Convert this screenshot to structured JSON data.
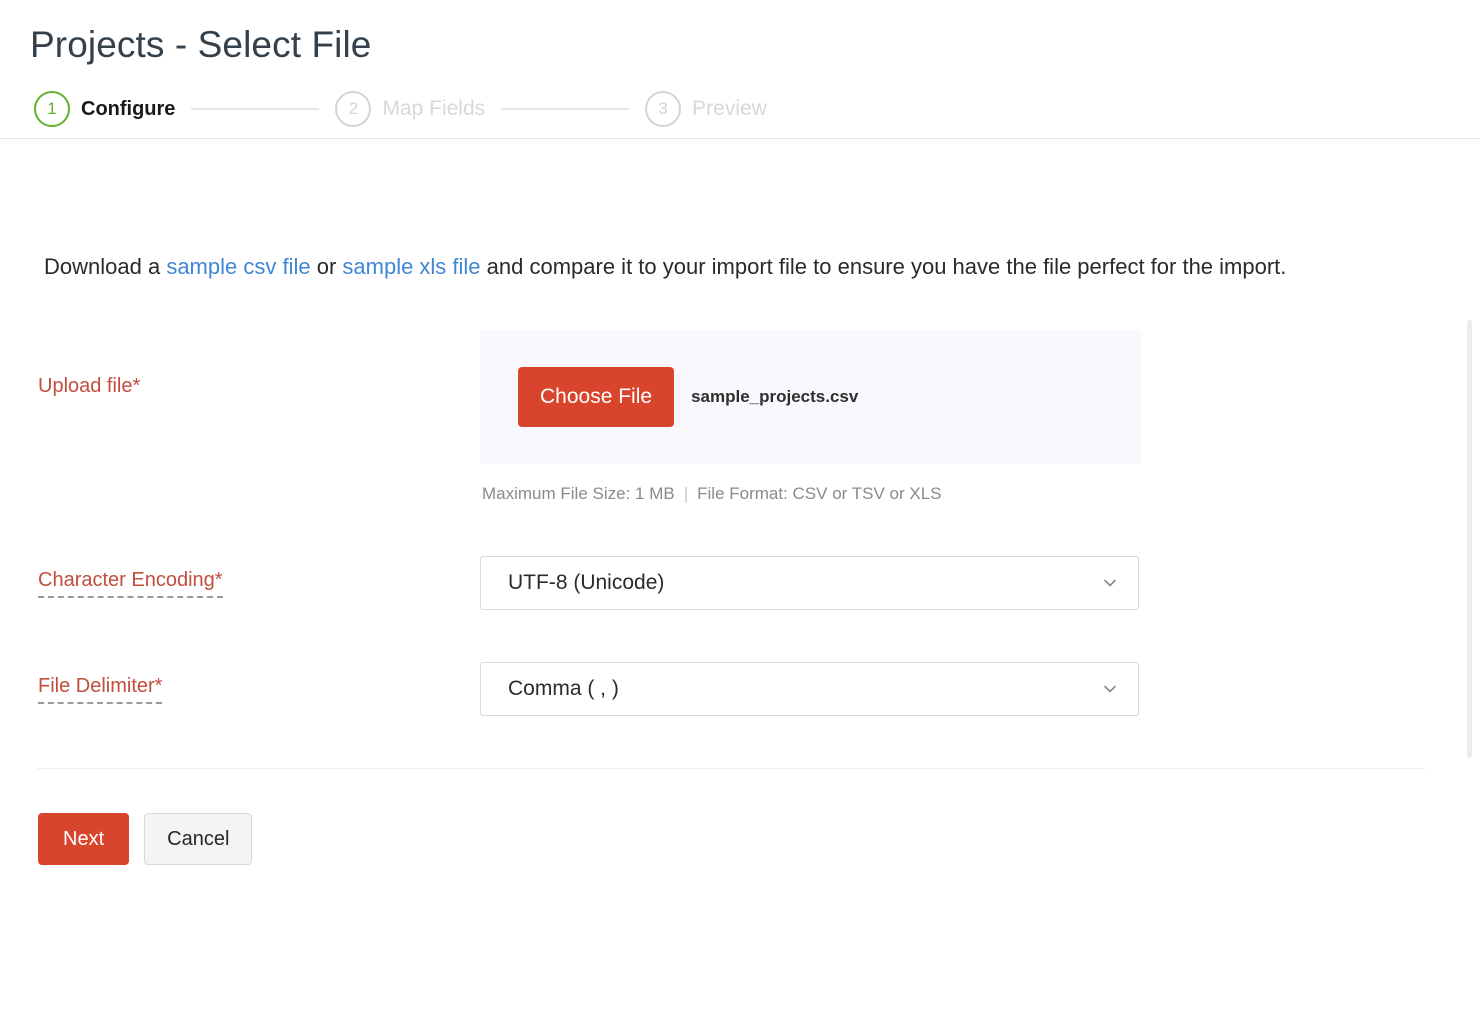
{
  "page": {
    "title": "Projects - Select File"
  },
  "stepper": {
    "steps": [
      {
        "number": "1",
        "label": "Configure",
        "state": "active"
      },
      {
        "number": "2",
        "label": "Map Fields",
        "state": "inactive"
      },
      {
        "number": "3",
        "label": "Preview",
        "state": "inactive"
      }
    ]
  },
  "intro": {
    "lead": "Download a ",
    "link_csv": "sample csv file",
    "between": " or ",
    "link_xls": "sample xls file",
    "tail": " and compare it to your import file to ensure you have the file perfect for the import."
  },
  "form": {
    "upload": {
      "label": "Upload file*",
      "choose_button": "Choose File",
      "file_name": "sample_projects.csv",
      "hint_size": "Maximum File Size: 1 MB",
      "hint_separator": "|",
      "hint_format": "File Format: CSV or TSV or XLS"
    },
    "encoding": {
      "label": "Character Encoding*",
      "value": "UTF-8 (Unicode)",
      "icon": "chevron-down-icon"
    },
    "delimiter": {
      "label": "File Delimiter*",
      "value": "Comma ( , )",
      "icon": "chevron-down-icon"
    }
  },
  "actions": {
    "next": "Next",
    "cancel": "Cancel"
  },
  "colors": {
    "accent_red": "#d9452c",
    "label_red": "#c24e3e",
    "link_blue": "#3f87d4",
    "step_active_green": "#62b22e",
    "upload_box_bg": "#f9f8fd"
  }
}
